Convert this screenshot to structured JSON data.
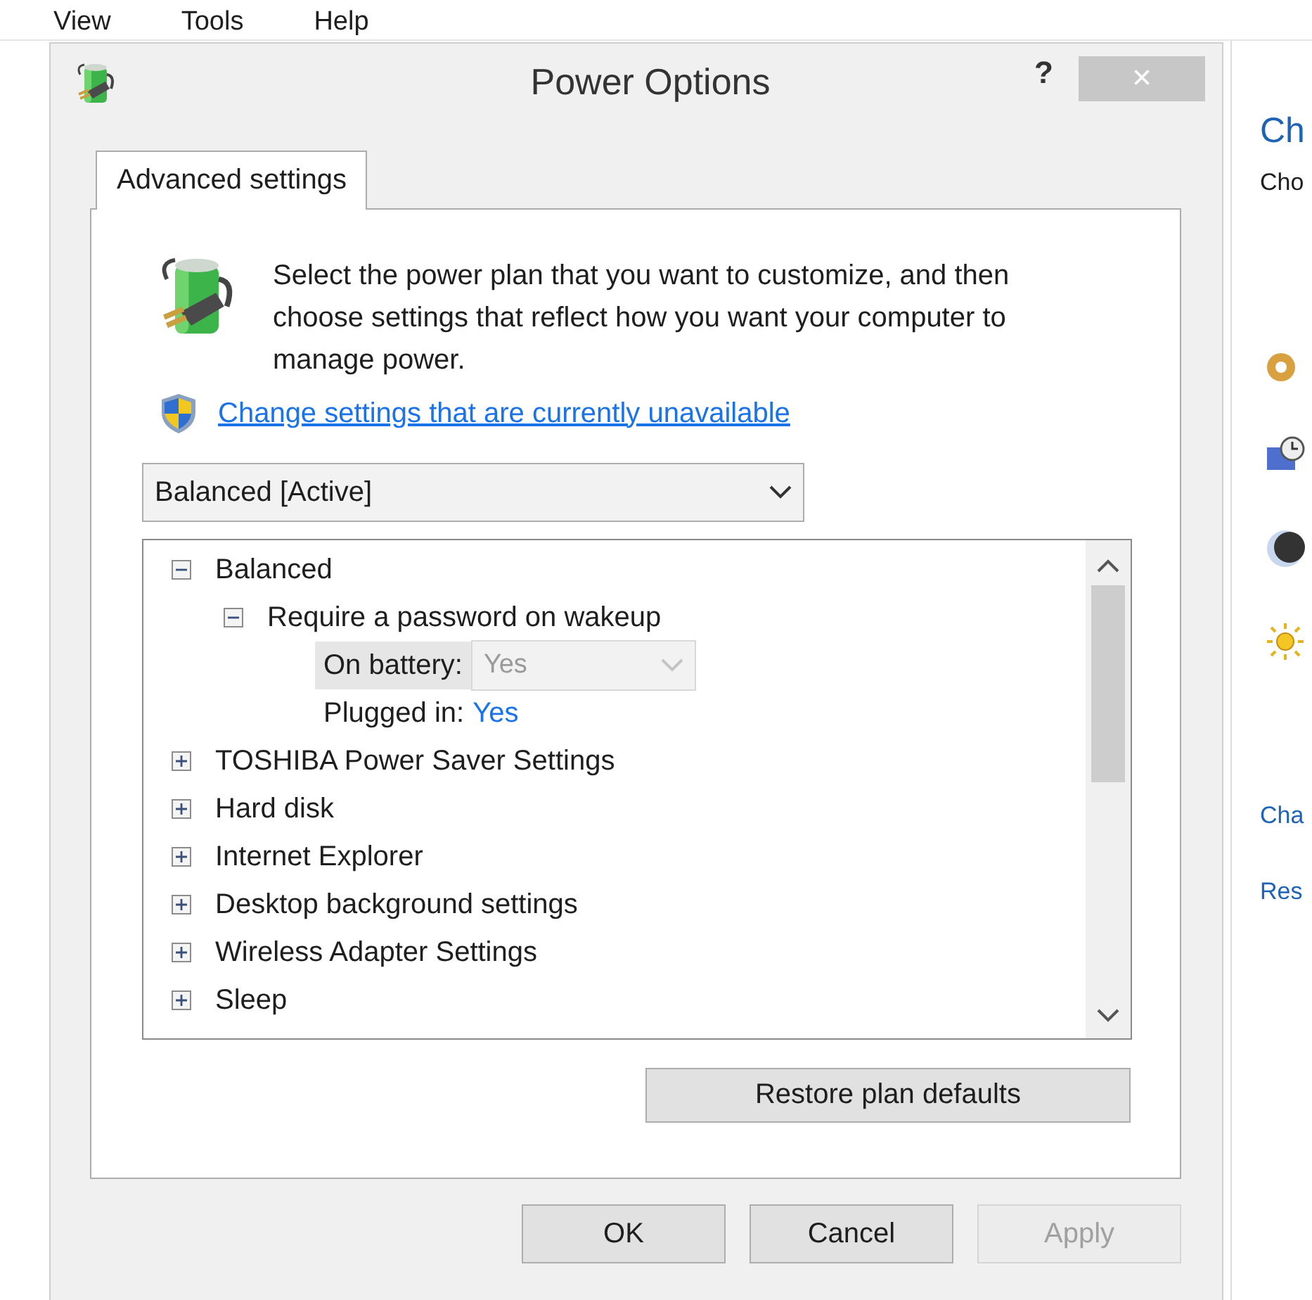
{
  "menu": [
    "View",
    "Tools",
    "Help"
  ],
  "background_panel": {
    "heading": "Ch",
    "subheading": "Cho",
    "links": [
      "Cha",
      "Res"
    ]
  },
  "dialog": {
    "title": "Power Options",
    "help": "?",
    "close": "×",
    "tabs": [
      {
        "label": "Advanced settings",
        "selected": true
      }
    ],
    "intro": "Select the power plan that you want to customize, and then choose settings that reflect how you want your computer to manage power.",
    "link": "Change settings that are currently unavailable",
    "plan_dropdown": {
      "value": "Balanced [Active]"
    },
    "tree": [
      {
        "label": "Balanced",
        "expanded": true,
        "children": [
          {
            "label": "Require a password on wakeup",
            "expanded": true,
            "settings": [
              {
                "label": "On battery:",
                "value": "Yes",
                "kind": "dropdown",
                "selected": true,
                "disabled": true
              },
              {
                "label": "Plugged in:",
                "value": "Yes",
                "kind": "link",
                "selected": false,
                "disabled": false
              }
            ]
          }
        ]
      },
      {
        "label": "TOSHIBA Power Saver Settings",
        "expanded": false
      },
      {
        "label": "Hard disk",
        "expanded": false
      },
      {
        "label": "Internet Explorer",
        "expanded": false
      },
      {
        "label": "Desktop background settings",
        "expanded": false
      },
      {
        "label": "Wireless Adapter Settings",
        "expanded": false
      },
      {
        "label": "Sleep",
        "expanded": false
      }
    ],
    "restore_button": "Restore plan defaults",
    "buttons": [
      {
        "label": "OK",
        "disabled": false
      },
      {
        "label": "Cancel",
        "disabled": false
      },
      {
        "label": "Apply",
        "disabled": true
      }
    ]
  }
}
